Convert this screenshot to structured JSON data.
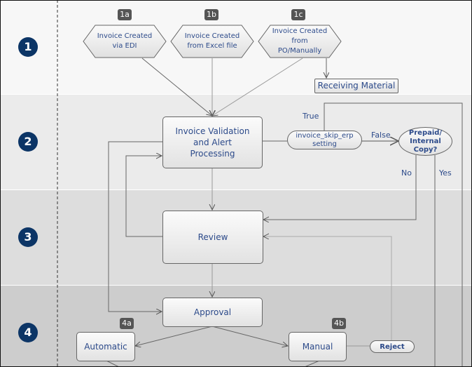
{
  "lanes": [
    {
      "number": "1",
      "color": "#f7f7f7"
    },
    {
      "number": "2",
      "color": "#ebebeb"
    },
    {
      "number": "3",
      "color": "#dddddd"
    },
    {
      "number": "4",
      "color": "#cdcdcd"
    }
  ],
  "sources": [
    {
      "badge": "1a",
      "label": "Invoice Created via EDI"
    },
    {
      "badge": "1b",
      "label": "Invoice Created from  Excel file"
    },
    {
      "badge": "1c",
      "label": "Invoice Created from PO/Manually"
    }
  ],
  "receiving": "Receiving Material",
  "validation": "Invoice Validation and Alert Processing",
  "skip_setting": "invoice_skip_erp setting",
  "prepaid": "Prepaid/ Internal Copy?",
  "labels": {
    "true": "True",
    "false": "False",
    "no": "No",
    "yes": "Yes"
  },
  "review": "Review",
  "approval": "Approval",
  "automatic": {
    "badge": "4a",
    "label": "Automatic"
  },
  "manual": {
    "badge": "4b",
    "label": "Manual"
  },
  "reject": "Reject"
}
